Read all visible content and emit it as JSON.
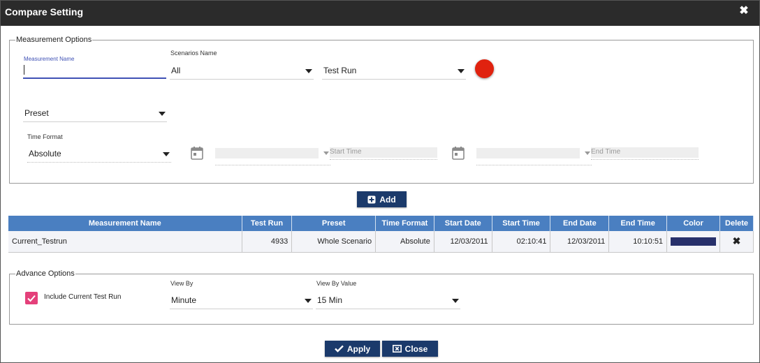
{
  "dialog": {
    "title": "Compare Setting",
    "close_glyph": "✖"
  },
  "measurement_options": {
    "legend": "Measurement Options",
    "measurement_name": {
      "label": "Measurement Name",
      "value": ""
    },
    "scenarios": {
      "label": "Scenarios Name",
      "value": "All"
    },
    "test_run": {
      "value": "Test Run"
    },
    "color_swatch": "#e0220f",
    "preset": {
      "value": "Preset"
    },
    "time_format": {
      "label": "Time Format",
      "value": "Absolute"
    },
    "start_time": {
      "placeholder": "Start Time"
    },
    "end_time": {
      "placeholder": "End Time"
    }
  },
  "buttons": {
    "add": "Add",
    "apply": "Apply",
    "close": "Close"
  },
  "table": {
    "headers": [
      "Measurement Name",
      "Test Run",
      "Preset",
      "Time Format",
      "Start Date",
      "Start Time",
      "End Date",
      "End Time",
      "Color",
      "Delete"
    ],
    "rows": [
      {
        "measurement_name": "Current_Testrun",
        "test_run": "4933",
        "preset": "Whole Scenario",
        "time_format": "Absolute",
        "start_date": "12/03/2011",
        "start_time": "02:10:41",
        "end_date": "12/03/2011",
        "end_time": "10:10:51",
        "color": "#27306b",
        "delete_glyph": "✖"
      }
    ]
  },
  "advance_options": {
    "legend": "Advance Options",
    "include_current": {
      "label": "Include Current Test Run",
      "checked": true
    },
    "view_by": {
      "label": "View By",
      "value": "Minute"
    },
    "view_by_value": {
      "label": "View By Value",
      "value": "15 Min"
    }
  },
  "colors": {
    "titlebar": "#2b2b2b",
    "header": "#4a7fc1",
    "button": "#1b3a6b",
    "checkbox": "#e4407a"
  }
}
